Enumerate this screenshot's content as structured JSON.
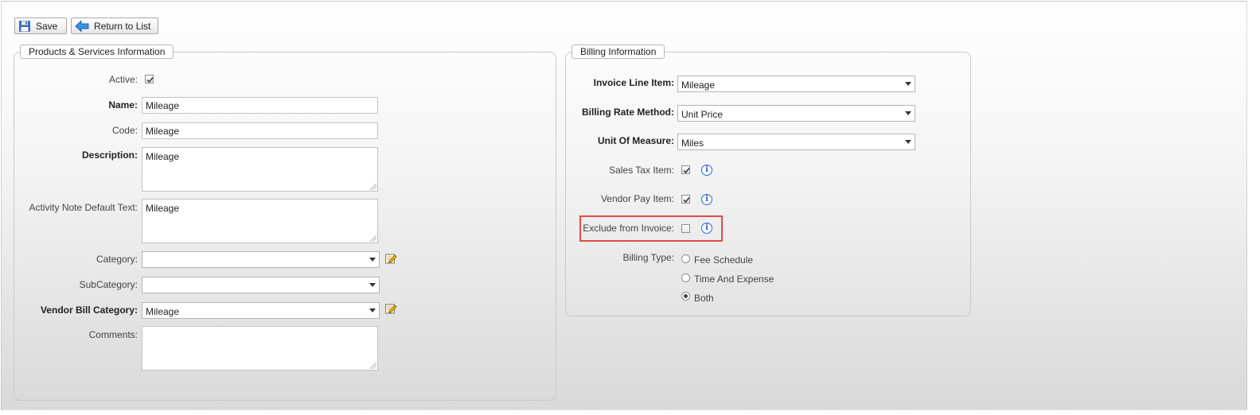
{
  "toolbar": {
    "save_label": "Save",
    "return_label": "Return to List"
  },
  "products": {
    "legend": "Products & Services Information",
    "active_label": "Active:",
    "active_checked": true,
    "name_label": "Name:",
    "name_value": "Mileage",
    "code_label": "Code:",
    "code_value": "Mileage",
    "description_label": "Description:",
    "description_value": "Mileage",
    "activity_note_label": "Activity Note Default Text:",
    "activity_note_value": "Mileage",
    "category_label": "Category:",
    "category_value": "",
    "subcategory_label": "SubCategory:",
    "subcategory_value": "",
    "vendor_bill_category_label": "Vendor Bill Category:",
    "vendor_bill_category_value": "Mileage",
    "comments_label": "Comments:",
    "comments_value": ""
  },
  "billing": {
    "legend": "Billing Information",
    "invoice_line_item_label": "Invoice Line Item:",
    "invoice_line_item_value": "Mileage",
    "billing_rate_method_label": "Billing Rate Method:",
    "billing_rate_method_value": "Unit Price",
    "unit_of_measure_label": "Unit Of Measure:",
    "unit_of_measure_value": "Miles",
    "sales_tax_label": "Sales Tax Item:",
    "sales_tax_checked": true,
    "vendor_pay_label": "Vendor Pay Item:",
    "vendor_pay_checked": true,
    "exclude_label": "Exclude from Invoice:",
    "exclude_checked": false,
    "billing_type_label": "Billing Type:",
    "billing_type_options": [
      "Fee Schedule",
      "Time And Expense",
      "Both"
    ],
    "billing_type_selected": "Both"
  },
  "colors": {
    "highlight": "#e34a4a",
    "info_icon": "#2f63d6"
  },
  "icons": {
    "save": "floppy-disk-icon",
    "return": "back-arrow-icon",
    "edit": "edit-pencil-icon",
    "info": "info-icon"
  }
}
